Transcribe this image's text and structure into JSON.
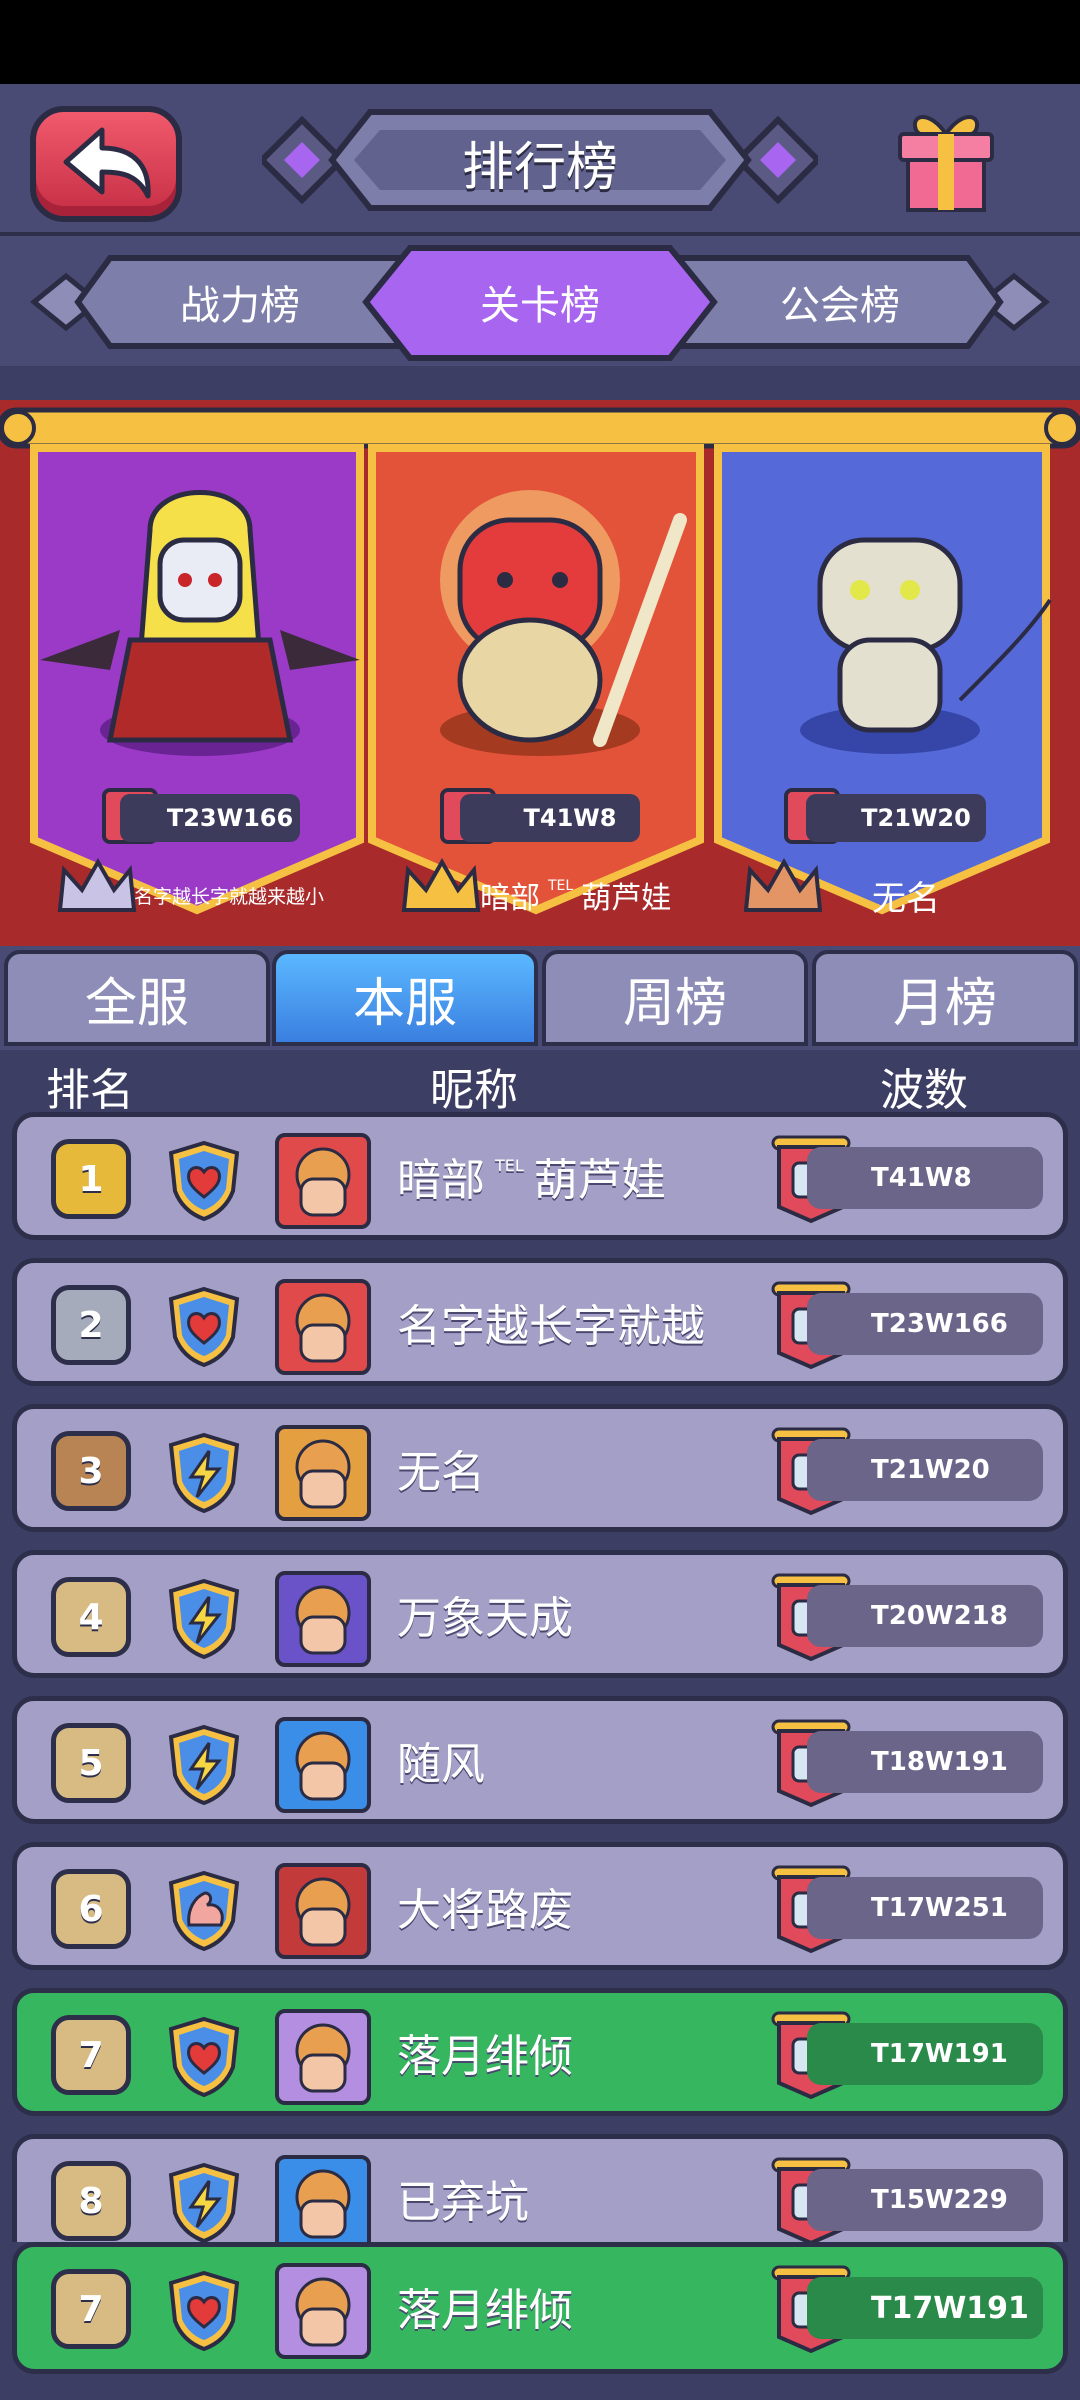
{
  "header": {
    "title": "排行榜",
    "back_icon": "back-arrow-icon",
    "gift_icon": "gift-icon"
  },
  "tabs": [
    {
      "label": "战力榜"
    },
    {
      "label": "关卡榜",
      "active": true
    },
    {
      "label": "公会榜"
    }
  ],
  "podium": [
    {
      "wave": "T23W166",
      "name": "名字越长字就越来越小",
      "crown": "silver"
    },
    {
      "wave": "T41W8",
      "name": "暗部",
      "tag": "TEL",
      "name2": "葫芦娃",
      "crown": "gold"
    },
    {
      "wave": "T21W20",
      "name": "无名",
      "crown": "bronze"
    }
  ],
  "filters": [
    {
      "label": "全服"
    },
    {
      "label": "本服",
      "active": true
    },
    {
      "label": "周榜"
    },
    {
      "label": "月榜"
    }
  ],
  "columns": {
    "rank": "排名",
    "nickname": "昵称",
    "wave": "波数"
  },
  "rows": [
    {
      "rank": "1",
      "name": "暗部",
      "tag": "TEL",
      "name2": "葫芦娃",
      "wave": "T41W8",
      "badge": "heart",
      "rank_color": "#e7b93a"
    },
    {
      "rank": "2",
      "name": "名字越长字就越",
      "wave": "T23W166",
      "badge": "heart",
      "rank_color": "#a5abbb"
    },
    {
      "rank": "3",
      "name": "无名",
      "wave": "T21W20",
      "badge": "lightning",
      "rank_color": "#b98453"
    },
    {
      "rank": "4",
      "name": "万象天成",
      "wave": "T20W218",
      "badge": "lightning",
      "rank_color": "#d8bb82"
    },
    {
      "rank": "5",
      "name": "随风",
      "wave": "T18W191",
      "badge": "lightning",
      "rank_color": "#d8bb82"
    },
    {
      "rank": "6",
      "name": "大将路废",
      "wave": "T17W251",
      "badge": "muscle",
      "rank_color": "#d8bb82"
    },
    {
      "rank": "7",
      "name": "落月绯倾",
      "wave": "T17W191",
      "badge": "heart",
      "rank_color": "#d8bb82",
      "me": true
    },
    {
      "rank": "8",
      "name": "已弃坑",
      "wave": "T15W229",
      "badge": "lightning",
      "rank_color": "#d8bb82"
    }
  ],
  "my_row": {
    "rank": "7",
    "name": "落月绯倾",
    "wave": "T17W191",
    "badge": "heart"
  },
  "colors": {
    "accent": "#a865f0",
    "me_row": "#37b660",
    "banner": "#a82a2a"
  }
}
